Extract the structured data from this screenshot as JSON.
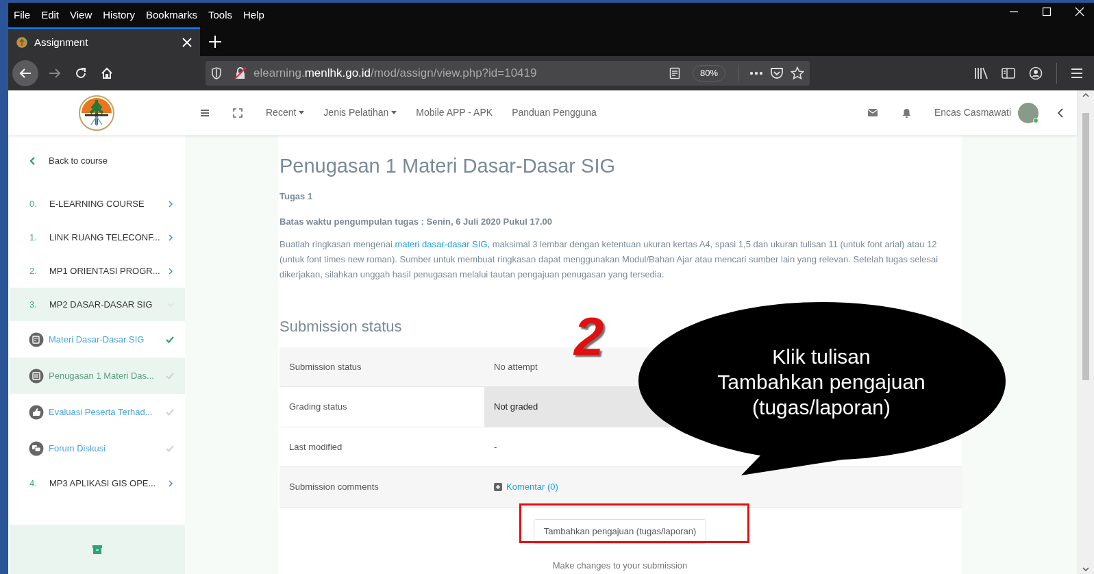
{
  "menu_bar": [
    "File",
    "Edit",
    "View",
    "History",
    "Bookmarks",
    "Tools",
    "Help"
  ],
  "tab": {
    "title": "Assignment"
  },
  "address_bar": {
    "prefix": "elearning.",
    "domain": "menlhk.go.id",
    "path": "/mod/assign/view.php?id=10419",
    "zoom": "80%"
  },
  "site_nav": [
    {
      "label": "Recent",
      "dropdown": true
    },
    {
      "label": "Jenis Pelatihan",
      "dropdown": true
    },
    {
      "label": "Mobile APP - APK",
      "dropdown": false
    },
    {
      "label": "Panduan Pengguna",
      "dropdown": false
    }
  ],
  "user": {
    "name": "Encas Casmawati"
  },
  "sidebar": {
    "back": "Back to course",
    "items": [
      {
        "kind": "section",
        "number": "0.",
        "label": "E-LEARNING COURSE",
        "expanded": false,
        "selected": false
      },
      {
        "kind": "section",
        "number": "1.",
        "label": "LINK RUANG TELECONF...",
        "expanded": false,
        "selected": false
      },
      {
        "kind": "section",
        "number": "2.",
        "label": "MP1 ORIENTASI PROGR...",
        "expanded": false,
        "selected": false
      },
      {
        "kind": "section",
        "number": "3.",
        "label": "MP2 DASAR-DASAR SIG",
        "expanded": true,
        "selected": true
      },
      {
        "kind": "activity",
        "label": "Materi Dasar-Dasar SIG",
        "completed": true,
        "selected": false
      },
      {
        "kind": "activity",
        "label": "Penugasan 1 Materi Das...",
        "completed": false,
        "selected": true
      },
      {
        "kind": "activity",
        "label": "Evaluasi Peserta Terhad...",
        "completed": false,
        "selected": false
      },
      {
        "kind": "activity",
        "label": "Forum Diskusi",
        "completed": false,
        "selected": false
      },
      {
        "kind": "section",
        "number": "4.",
        "label": "MP3 APLIKASI GIS OPE...",
        "expanded": false,
        "selected": false
      }
    ]
  },
  "assignment": {
    "title": "Penugasan 1 Materi Dasar-Dasar SIG",
    "subtitle": "Tugas 1",
    "deadline": "Batas waktu pengumpulan tugas : Senin, 6 Juli 2020 Pukul 17.00",
    "description_before": "Buatlah ringkasan mengenai ",
    "description_link": "materi dasar-dasar SIG",
    "description_after": ", maksimal 3 lembar dengan ketentuan ukuran kertas A4,  spasi 1,5 dan ukuran tulisan 11 (untuk font arial) atau 12 (untuk font times new roman). Sumber untuk membuat ringkasan dapat menggunakan Modul/Bahan Ajar atau mencari sumber lain yang relevan. Setelah tugas selesai dikerjakan, silahkan unggah hasil penugasan melalui tautan pengajuan penugasan yang tersedia."
  },
  "submission": {
    "heading": "Submission status",
    "rows": [
      {
        "kind": "text",
        "label": "Submission status",
        "value": "No attempt",
        "shaded": false
      },
      {
        "kind": "text",
        "label": "Grading status",
        "value": "Not graded",
        "shaded": true
      },
      {
        "kind": "text",
        "label": "Last modified",
        "value": "-",
        "shaded": false
      },
      {
        "kind": "link",
        "label": "Submission comments",
        "value": "Komentar (0)",
        "shaded": false
      }
    ],
    "button": "Tambahkan pengajuan (tugas/laporan)",
    "note": "Make changes to your submission"
  },
  "annotation": {
    "step": "2",
    "callout": "Klik tulisan\nTambahkan pengajuan\n(tugas/laporan)"
  }
}
